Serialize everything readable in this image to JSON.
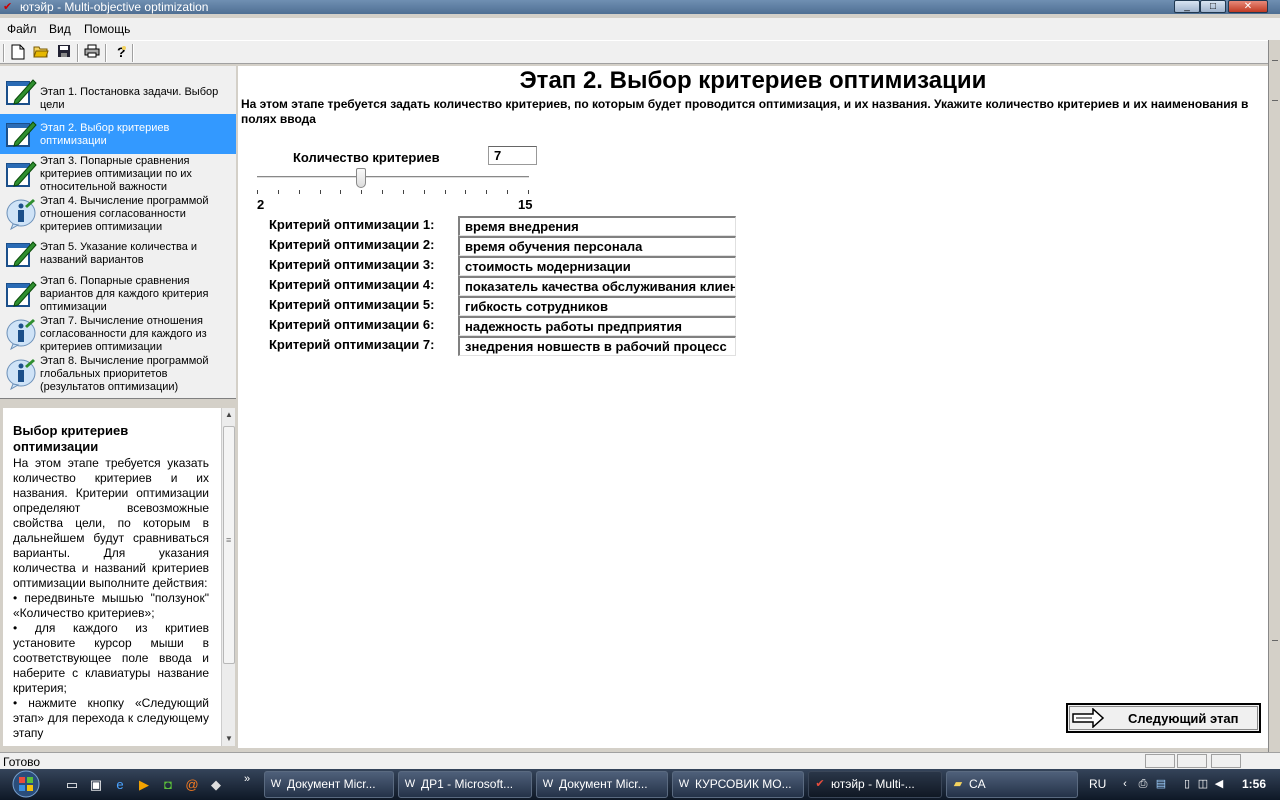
{
  "window": {
    "title": "ютэйр - Multi-objective optimization"
  },
  "menu": {
    "items": [
      "Файл",
      "Вид",
      "Помощь"
    ]
  },
  "toolbar": {
    "icons": [
      "new-file-icon",
      "open-folder-icon",
      "save-icon",
      "print-icon",
      "help-icon"
    ]
  },
  "steps": [
    {
      "label": "Этап 1. Постановка задачи. Выбор цели",
      "icon": "edit-icon",
      "active": false
    },
    {
      "label": "Этап 2. Выбор критериев оптимизации",
      "icon": "edit-icon",
      "active": true
    },
    {
      "label": "Этап 3. Попарные сравнения критериев оптимизации по их относительной важности",
      "icon": "edit-icon",
      "active": false
    },
    {
      "label": "Этап 4. Вычисление программой отношения согласованности критериев оптимизации",
      "icon": "info-icon",
      "active": false
    },
    {
      "label": "Этап 5. Указание количества и названий вариантов",
      "icon": "edit-icon",
      "active": false
    },
    {
      "label": "Этап 6. Попарные сравнения вариантов для каждого критерия оптимизации",
      "icon": "edit-icon",
      "active": false
    },
    {
      "label": "Этап 7. Вычисление отношения согласованности для каждого из критериев оптимизации",
      "icon": "info-icon",
      "active": false
    },
    {
      "label": "Этап 8. Вычисление программой глобальных приоритетов (результатов оптимизации)",
      "icon": "info-icon",
      "active": false
    }
  ],
  "help": {
    "title": "Выбор критериев оптимизации",
    "paragraphs": [
      "На этом этапе требуется указать количество критериев и их названия. Критерии оптимизации определяют всевозможные свойства цели, по которым в дальнейшем будут сравниваться варианты. Для указания количества и названий критериев оптимизации выполните действия:",
      "• передвиньте мышью \"ползунок\" «Количество критериев»;",
      "• для каждого из критиев установите курсор мыши в соответствующее поле ввода и наберите с клавиатуры название критерия;",
      "• нажмите кнопку «Следующий этап» для перехода к следующему этапу"
    ]
  },
  "main": {
    "title": "Этап 2. Выбор критериев оптимизации",
    "description": "На этом этапе требуется задать количество критериев, по которым будет проводится оптимизация, и их названия. Укажите количество критериев и их наименования в полях ввода",
    "count_label": "Количество критериев",
    "count_value": "7",
    "slider": {
      "min": 2,
      "max": 15,
      "value": 7,
      "min_label": "2",
      "max_label": "15"
    },
    "criteria": [
      {
        "label": "Критерий оптимизации 1:",
        "value": "время внедрения"
      },
      {
        "label": "Критерий оптимизации 2:",
        "value": "время обучения персонала"
      },
      {
        "label": "Критерий оптимизации 3:",
        "value": "стоимость модернизации"
      },
      {
        "label": "Критерий оптимизации 4:",
        "value": "показатель качества обслуживания клиентов"
      },
      {
        "label": "Критерий оптимизации 5:",
        "value": "гибкость сотрудников"
      },
      {
        "label": "Критерий оптимизации 6:",
        "value": "надежность работы предприятия"
      },
      {
        "label": "Критерий оптимизации 7:",
        "value": "знедрения новшеств в рабочий процесс"
      }
    ],
    "next_button": "Следующий этап"
  },
  "status": {
    "text": "Готово"
  },
  "taskbar": {
    "tasks": [
      {
        "label": "Документ Micr...",
        "icon": "word-icon",
        "active": false
      },
      {
        "label": "ДР1 - Microsoft...",
        "icon": "word-icon",
        "active": false
      },
      {
        "label": "Документ Micr...",
        "icon": "word-icon",
        "active": false
      },
      {
        "label": "КУРСОВИК МО...",
        "icon": "word-icon",
        "active": false
      },
      {
        "label": "ютэйр - Multi-...",
        "icon": "app-icon",
        "active": true
      },
      {
        "label": "CA",
        "icon": "folder-icon",
        "active": false
      }
    ],
    "language": "RU",
    "clock": "1:56"
  }
}
